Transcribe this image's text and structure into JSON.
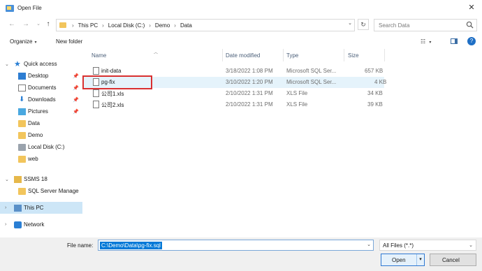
{
  "window": {
    "title": "Open File"
  },
  "address": {
    "crumbs": [
      "This PC",
      "Local Disk (C:)",
      "Demo",
      "Data"
    ]
  },
  "search": {
    "placeholder": "Search Data"
  },
  "toolbar": {
    "organize": "Organize",
    "new_folder": "New folder"
  },
  "navpane": {
    "items": [
      {
        "label": "Quick access",
        "icon": "star-icon"
      },
      {
        "label": "Desktop",
        "icon": "desktop-icon",
        "pinned": true
      },
      {
        "label": "Documents",
        "icon": "documents-icon",
        "pinned": true
      },
      {
        "label": "Downloads",
        "icon": "downloads-icon",
        "pinned": true
      },
      {
        "label": "Pictures",
        "icon": "pictures-icon",
        "pinned": true
      },
      {
        "label": "Data",
        "icon": "folder-icon"
      },
      {
        "label": "Demo",
        "icon": "folder-icon"
      },
      {
        "label": "Local Disk (C:)",
        "icon": "disk-icon"
      },
      {
        "label": "web",
        "icon": "folder-icon"
      },
      {
        "label": "SSMS 18",
        "icon": "ssms-icon"
      },
      {
        "label": "SQL Server Manage",
        "icon": "folder-icon"
      },
      {
        "label": "This PC",
        "icon": "pc-icon",
        "selected": true
      },
      {
        "label": "Network",
        "icon": "network-icon"
      }
    ]
  },
  "filelist": {
    "columns": [
      "Name",
      "Date modified",
      "Type",
      "Size"
    ],
    "rows": [
      {
        "name": "init-data",
        "date": "3/18/2022 1:08 PM",
        "type": "Microsoft SQL Ser...",
        "size": "657 KB"
      },
      {
        "name": "pg-fix",
        "date": "3/10/2022 1:20 PM",
        "type": "Microsoft SQL Ser...",
        "size": "4 KB",
        "selected": true
      },
      {
        "name": "公司1.xls",
        "date": "2/10/2022 1:31 PM",
        "type": "XLS File",
        "size": "34 KB"
      },
      {
        "name": "公司2.xls",
        "date": "2/10/2022 1:31 PM",
        "type": "XLS File",
        "size": "39 KB"
      }
    ]
  },
  "footer": {
    "filename_label": "File name:",
    "filename_value": "C:\\Demo\\Data\\pg-fix.sql",
    "filetype_value": "All Files (*.*)",
    "open_label": "Open",
    "cancel_label": "Cancel"
  },
  "colors": {
    "accent": "#0078d7",
    "selected_row": "#e5f3fb",
    "nav_selected": "#cde6f7",
    "callout": "#d93030"
  }
}
